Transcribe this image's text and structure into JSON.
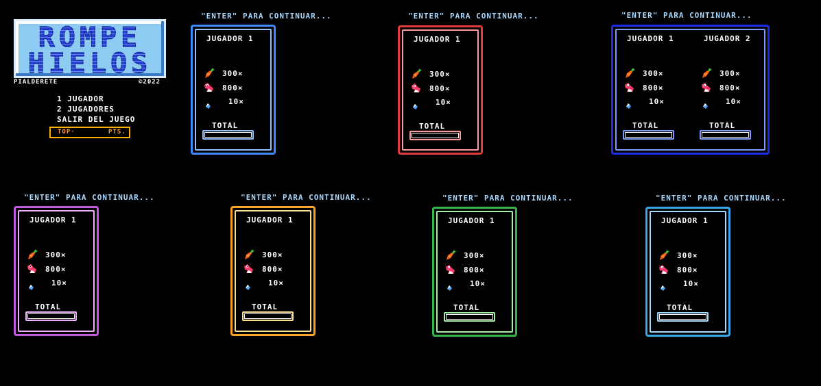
{
  "logo": {
    "line1": "ROMPE",
    "line2": "HIELOS"
  },
  "credits": {
    "author": "PIALDERETE",
    "year": "©2022"
  },
  "menu": {
    "items": [
      "1 JUGADOR",
      "2 JUGADORES",
      "SALIR DEL JUEGO"
    ]
  },
  "topscore": {
    "top_label": "TOP·",
    "pts_label": "PTS."
  },
  "common": {
    "enter_prompt": "\"ENTER\" PARA CONTINUAR...",
    "player1": "JUGADOR 1",
    "player2": "JUGADOR 2",
    "carrot_score": "300×",
    "fish_score": "800×",
    "ice_score": "10×",
    "total_label": "TOTAL"
  },
  "panels": [
    {
      "id": "blue",
      "border": "#3c8cff",
      "inner": "#8fc0ff",
      "players": 1
    },
    {
      "id": "red",
      "border": "#e23b3b",
      "inner": "#ff9a9a",
      "players": 1
    },
    {
      "id": "navy",
      "border": "#1e2ee8",
      "inner": "#7e9bff",
      "players": 2
    },
    {
      "id": "purple",
      "border": "#c25bde",
      "inner": "#f0b0ff",
      "players": 1
    },
    {
      "id": "orange",
      "border": "#ffa423",
      "inner": "#ffe08a",
      "players": 1
    },
    {
      "id": "green",
      "border": "#36b54a",
      "inner": "#a8f0a8",
      "players": 1
    },
    {
      "id": "lightblue",
      "border": "#3aa6e8",
      "inner": "#a8dcff",
      "players": 1
    }
  ],
  "icons": [
    "carrot-icon",
    "fish-icon",
    "ice-icon"
  ]
}
